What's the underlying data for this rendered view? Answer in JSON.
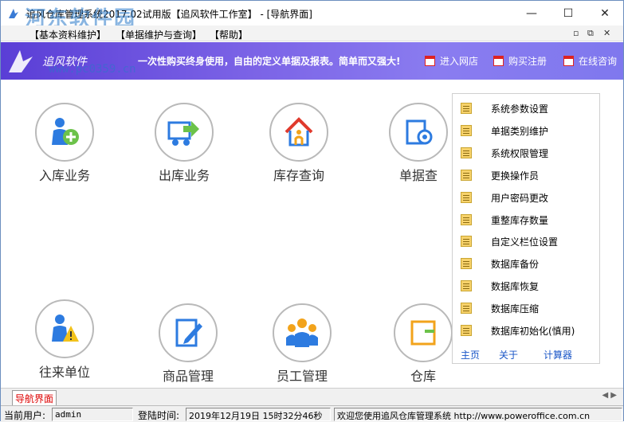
{
  "window": {
    "title": "追风仓库管理系统2017.02试用版【追风软件工作室】 - [导航界面]",
    "controls": [
      "—",
      "☐",
      "✕"
    ]
  },
  "watermark": {
    "line1": "河东软件园",
    "line2": "www.pc0359.cn"
  },
  "menubar": {
    "items": [
      "【基本资料维护】",
      "【单据维护与查询】",
      "【帮助】"
    ],
    "mdi_controls": [
      "▫",
      "⧉",
      "✕"
    ]
  },
  "banner": {
    "brand": "追风软件",
    "slogan": "一次性购买终身使用，自由的定义单据及报表。简单而又强大!",
    "links": [
      "进入网店",
      "购买注册",
      "在线咨询"
    ]
  },
  "tiles": [
    {
      "label": "入库业务",
      "icon": "stock-in-icon"
    },
    {
      "label": "出库业务",
      "icon": "stock-out-icon"
    },
    {
      "label": "库存查询",
      "icon": "inventory-query-icon"
    },
    {
      "label": "单据查",
      "icon": "document-query-icon"
    },
    {
      "label": "往来单位",
      "icon": "partner-icon"
    },
    {
      "label": "商品管理",
      "icon": "product-management-icon"
    },
    {
      "label": "员工管理",
      "icon": "employee-management-icon"
    },
    {
      "label": "仓库",
      "icon": "warehouse-icon"
    }
  ],
  "side_menu": {
    "items": [
      "系统参数设置",
      "单据类别维护",
      "系统权限管理",
      "更换操作员",
      "用户密码更改",
      "重整库存数量",
      "自定义栏位设置",
      "数据库备份",
      "数据库恢复",
      "数据库压缩",
      "数据库初始化(慎用)"
    ],
    "links": [
      "主页",
      "关于",
      "计算器"
    ]
  },
  "tabs": {
    "active": "导航界面"
  },
  "statusbar": {
    "user_label": "当前用户:",
    "user_value": "admin",
    "login_label": "登陆时间:",
    "login_value": "2019年12月19日 15时32分46秒",
    "welcome": "欢迎您使用追风仓库管理系统 http://www.poweroffice.com.cn"
  },
  "colors": {
    "banner": "#6a52e0",
    "accent_red": "#d00000",
    "link_blue": "#1a56c7"
  }
}
